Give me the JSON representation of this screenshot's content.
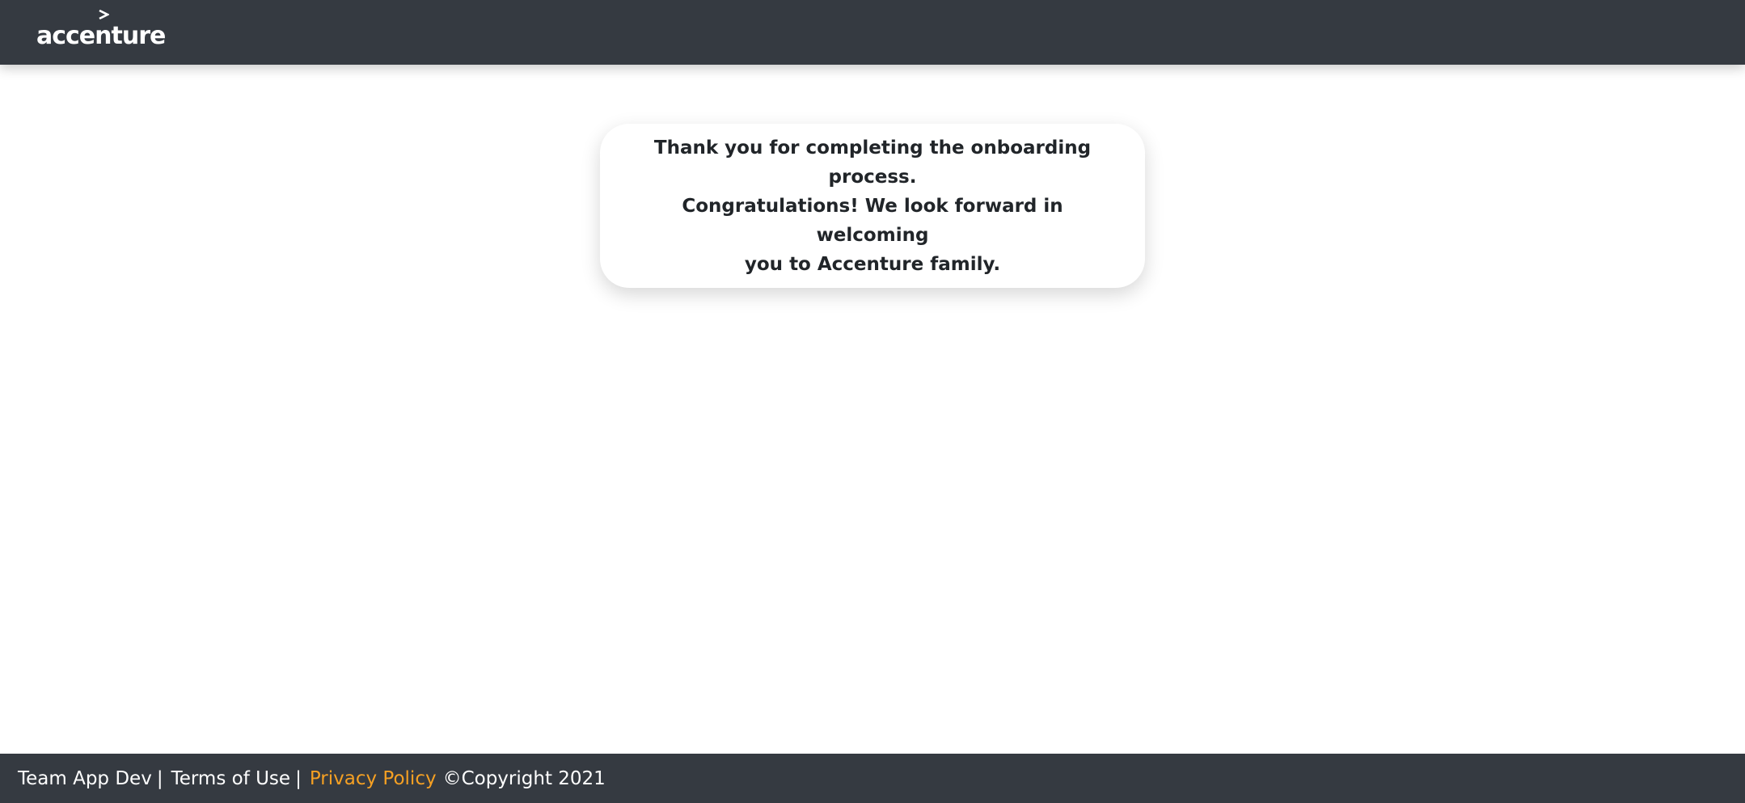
{
  "header": {
    "logo_text": "accenture",
    "logo_icon": "accenture-chevron-icon"
  },
  "message": {
    "line1": "Thank you for completing the onboarding process.",
    "line2": "Congratulations! We look forward in welcoming",
    "line3": "you to Accenture family."
  },
  "footer": {
    "team_label": "Team App Dev",
    "separator": "|",
    "terms_label": "Terms of Use",
    "privacy_label": "Privacy Policy",
    "copyright": "©Copyright 2021"
  },
  "colors": {
    "header_bg": "#353a41",
    "footer_bg": "#353a41",
    "link_accent": "#f5a023",
    "text_dark": "#212529"
  }
}
